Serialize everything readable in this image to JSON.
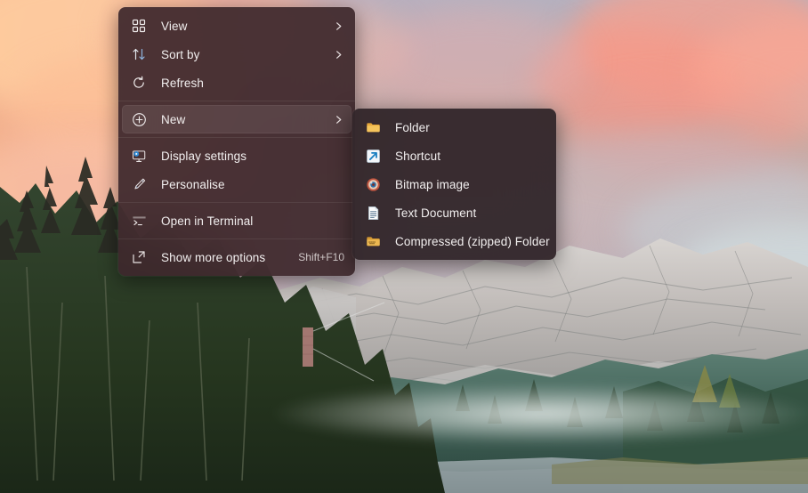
{
  "desktop": {
    "wallpaper_name": "eibsee-mountain-lake-sunset",
    "colors": {
      "sky_warm": "#f6b48c",
      "sky_cool": "#aebfcb",
      "cloud_pink": "#fca08c",
      "rock_grey": "#b9b6b4",
      "forest_dark": "#2c3a2a",
      "forest_teal": "#3f6155",
      "water": "#8d9ca0"
    }
  },
  "context_menu": {
    "name": "desktop-context-menu",
    "background_color": "#3d282c",
    "highlight_color": "#4b3438",
    "text_color": "#f2efef",
    "groups": [
      {
        "items": [
          {
            "id": "view",
            "label": "View",
            "icon": "grid-icon",
            "submenu": true,
            "accel": ""
          },
          {
            "id": "sort-by",
            "label": "Sort by",
            "icon": "sort-icon",
            "submenu": true,
            "accel": ""
          },
          {
            "id": "refresh",
            "label": "Refresh",
            "icon": "refresh-icon",
            "submenu": false,
            "accel": ""
          }
        ]
      },
      {
        "items": [
          {
            "id": "new",
            "label": "New",
            "icon": "plus-circle-icon",
            "submenu": true,
            "accel": "",
            "highlighted": true
          }
        ]
      },
      {
        "items": [
          {
            "id": "display-settings",
            "label": "Display settings",
            "icon": "monitor-icon",
            "submenu": false,
            "accel": ""
          },
          {
            "id": "personalise",
            "label": "Personalise",
            "icon": "brush-icon",
            "submenu": false,
            "accel": ""
          }
        ]
      },
      {
        "items": [
          {
            "id": "open-in-terminal",
            "label": "Open in Terminal",
            "icon": "terminal-icon",
            "submenu": false,
            "accel": ""
          }
        ]
      },
      {
        "items": [
          {
            "id": "show-more-options",
            "label": "Show more options",
            "icon": "expand-icon",
            "submenu": false,
            "accel": "Shift+F10"
          }
        ]
      }
    ]
  },
  "submenu": {
    "name": "new-submenu",
    "parent": "New",
    "background_color": "#302529",
    "items": [
      {
        "id": "folder",
        "label": "Folder",
        "icon": "folder-icon"
      },
      {
        "id": "shortcut",
        "label": "Shortcut",
        "icon": "shortcut-icon"
      },
      {
        "id": "bitmap-image",
        "label": "Bitmap image",
        "icon": "bitmap-image-icon"
      },
      {
        "id": "text-document",
        "label": "Text Document",
        "icon": "text-document-icon"
      },
      {
        "id": "compressed-folder",
        "label": "Compressed (zipped) Folder",
        "icon": "zipped-folder-icon"
      }
    ]
  }
}
